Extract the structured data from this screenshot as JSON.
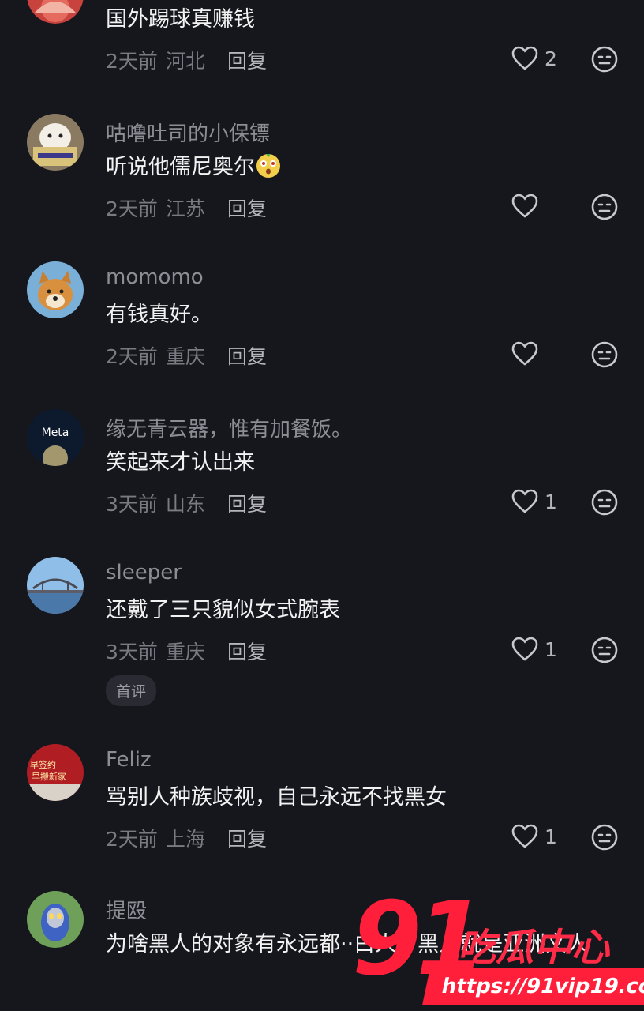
{
  "reply_label": "回复",
  "first_comment_tag": "首评",
  "accent_color": "#ff1f3a",
  "comments": [
    {
      "username": "",
      "avatar": "red-anime-avatar",
      "text": "国外踢球真赚钱",
      "time": "2天前",
      "location": "河北",
      "likes": "2"
    },
    {
      "username": "咕噜吐司的小保镖",
      "avatar": "dog-reading-avatar",
      "text": "听说他儒尼奥尔",
      "emoji": "surprised-face-emoji",
      "time": "2天前",
      "location": "江苏",
      "likes": ""
    },
    {
      "username": "momomo",
      "avatar": "shiba-dog-avatar",
      "text": "有钱真好。",
      "time": "2天前",
      "location": "重庆",
      "likes": ""
    },
    {
      "username": "缘无青云器，惟有加餐饭。",
      "avatar": "meta-logo-avatar",
      "avatar_text": "Meta",
      "text": "笑起来才认出来",
      "time": "3天前",
      "location": "山东",
      "likes": "1"
    },
    {
      "username": "sleeper",
      "avatar": "bridge-landscape-avatar",
      "text": "还戴了三只貌似女式腕表",
      "time": "3天前",
      "location": "重庆",
      "likes": "1",
      "tag": true
    },
    {
      "username": "Feliz",
      "avatar": "red-banner-avatar",
      "avatar_text_1": "早签约",
      "avatar_text_2": "早搬新家",
      "text": "骂别人种族歧视，自己永远不找黑女",
      "time": "2天前",
      "location": "上海",
      "likes": "1"
    },
    {
      "username": "提殴",
      "avatar": "ultraman-avatar",
      "text": "为啥黑人的对象有永远都··白人，黑人就是亚洲文人",
      "time": "",
      "location": "",
      "likes": ""
    }
  ],
  "watermark": {
    "number": "91",
    "brand": "吃瓜中心",
    "url": "https://91vip19.com"
  }
}
